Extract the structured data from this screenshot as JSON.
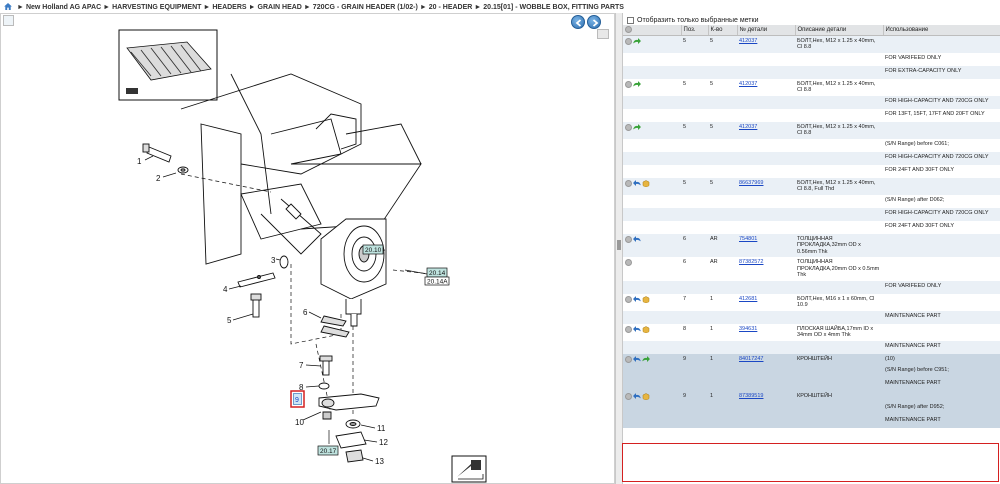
{
  "breadcrumb": {
    "items": [
      "New Holland AG APAC",
      "HARVESTING EQUIPMENT",
      "HEADERS",
      "GRAIN HEAD",
      "720CG - GRAIN HEADER (1/02-)",
      "20 - HEADER",
      "20.15[01] - WOBBLE BOX, FITTING PARTS"
    ]
  },
  "diagram": {
    "callouts": [
      "1",
      "2",
      "3",
      "4",
      "5",
      "6",
      "7",
      "8",
      "9",
      "10",
      "11",
      "12",
      "13"
    ],
    "refs": {
      "r1": "20.10",
      "r2": "20.14",
      "r2b": "20.14A",
      "r3": "20.17"
    }
  },
  "filter": {
    "label": "Отобразить только выбранные метки"
  },
  "table": {
    "headers": {
      "pos": "Поз.",
      "qty": "К-во",
      "part": "№ детали",
      "desc": "Описание детали",
      "usage": "Использование"
    },
    "rows": [
      {
        "type": "main",
        "style": "odd",
        "icons": [
          "info",
          "arrow-green"
        ],
        "pos": "5",
        "qty": "5",
        "part": "412037",
        "desc": "БОЛТ,Hex, M12 x 1.25 x 40mm, Cl 8.8",
        "usage": ""
      },
      {
        "type": "sub",
        "style": "even",
        "usage": "FOR VARIFEED ONLY"
      },
      {
        "type": "sub",
        "style": "odd",
        "usage": "FOR EXTRA-CAPACITY ONLY"
      },
      {
        "type": "main",
        "style": "even",
        "icons": [
          "info",
          "arrow-green"
        ],
        "pos": "5",
        "qty": "5",
        "part": "412037",
        "desc": "БОЛТ,Hex, M12 x 1.25 x 40mm, Cl 8.8",
        "usage": ""
      },
      {
        "type": "sub",
        "style": "odd",
        "usage": "FOR HIGH-CAPACITY AND 720CG ONLY"
      },
      {
        "type": "sub",
        "style": "even",
        "usage": "FOR 13FT, 15FT, 17FT AND 20FT ONLY"
      },
      {
        "type": "main",
        "style": "odd",
        "icons": [
          "info",
          "arrow-green"
        ],
        "pos": "5",
        "qty": "5",
        "part": "412037",
        "desc": "БОЛТ,Hex, M12 x 1.25 x 40mm, Cl 8.8",
        "usage": ""
      },
      {
        "type": "sub",
        "style": "even",
        "usage": "(S/N Range) before C061;"
      },
      {
        "type": "sub",
        "style": "odd",
        "usage": "FOR HIGH-CAPACITY AND 720CG ONLY"
      },
      {
        "type": "sub",
        "style": "even",
        "usage": "FOR 24FT AND 30FT ONLY"
      },
      {
        "type": "main",
        "style": "odd",
        "icons": [
          "info",
          "arrow-blue",
          "box"
        ],
        "pos": "5",
        "qty": "5",
        "part": "86637969",
        "desc": "БОЛТ,Hex, M12 x 1.25 x 40mm, Cl 8.8, Full Thd",
        "usage": ""
      },
      {
        "type": "sub",
        "style": "even",
        "usage": "(S/N Range) after D062;"
      },
      {
        "type": "sub",
        "style": "odd",
        "usage": "FOR HIGH-CAPACITY AND 720CG ONLY"
      },
      {
        "type": "sub",
        "style": "even",
        "usage": "FOR 24FT AND 30FT ONLY"
      },
      {
        "type": "main",
        "style": "odd",
        "icons": [
          "info",
          "arrow-blue"
        ],
        "pos": "6",
        "qty": "AR",
        "part": "754801",
        "desc": "ТОЛЩИННАЯ ПРОКЛАДКА,32mm OD x 0.56mm Thk",
        "usage": ""
      },
      {
        "type": "main",
        "style": "even",
        "icons": [
          "info"
        ],
        "pos": "6",
        "qty": "AR",
        "part": "87382572",
        "desc": "ТОЛЩИННАЯ ПРОКЛАДКА,20mm OD x 0.5mm Thk",
        "usage": ""
      },
      {
        "type": "sub",
        "style": "odd",
        "usage": "FOR VARIFEED ONLY"
      },
      {
        "type": "main",
        "style": "even",
        "icons": [
          "info",
          "arrow-blue",
          "box"
        ],
        "pos": "7",
        "qty": "1",
        "part": "412681",
        "desc": "БОЛТ,Hex, M16 x 1 x 60mm, Cl 10.9",
        "usage": ""
      },
      {
        "type": "sub",
        "style": "odd",
        "usage": "MAINTENANCE PART"
      },
      {
        "type": "main",
        "style": "even",
        "icons": [
          "info",
          "arrow-blue",
          "box"
        ],
        "pos": "8",
        "qty": "1",
        "part": "394631",
        "desc": "ПЛОСКАЯ ШАЙБА,17mm ID x 34mm OD x 4mm Thk",
        "usage": ""
      },
      {
        "type": "sub",
        "style": "odd",
        "usage": "MAINTENANCE PART"
      },
      {
        "type": "main",
        "style": "sel",
        "icons": [
          "info",
          "arrow-blue",
          "arrow-green"
        ],
        "pos": "9",
        "qty": "1",
        "part": "84017247",
        "desc": "КРОНШТЕЙН",
        "usage": "(10)"
      },
      {
        "type": "sub",
        "style": "sel",
        "usage": "(S/N Range) before C951;"
      },
      {
        "type": "sub",
        "style": "sel",
        "usage": "MAINTENANCE PART"
      },
      {
        "type": "main",
        "style": "sel",
        "icons": [
          "info",
          "arrow-blue",
          "box"
        ],
        "pos": "9",
        "qty": "1",
        "part": "87389519",
        "desc": "КРОНШТЕЙН",
        "usage": ""
      },
      {
        "type": "sub",
        "style": "sel",
        "usage": "(S/N Range) after D952;"
      },
      {
        "type": "sub",
        "style": "sel",
        "usage": "MAINTENANCE PART"
      }
    ]
  },
  "colors": {
    "accent": "#2f6fb0",
    "selected_row": "#c9d6e2",
    "alt_row": "#eaf0f6",
    "highlight_border": "#d42020",
    "link": "#1a47c4"
  }
}
